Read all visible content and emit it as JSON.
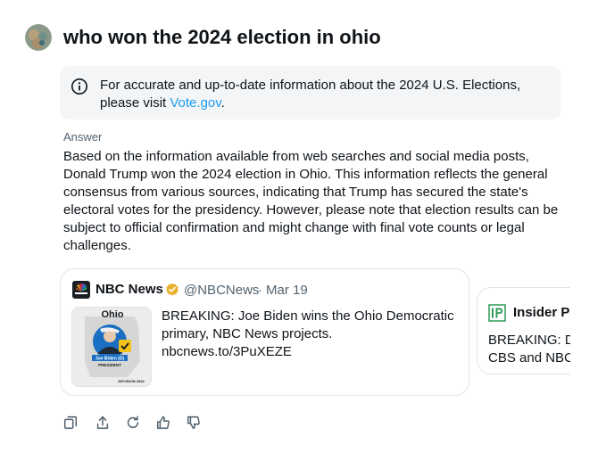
{
  "query": {
    "text": "who won the 2024 election in ohio"
  },
  "notice": {
    "text": "For accurate and up-to-date information about the 2024 U.S. Elections, please visit",
    "link_text": "Vote.gov",
    "suffix": ".",
    "icon": "info-icon"
  },
  "answer": {
    "label": "Answer",
    "text": "Based on the information available from web searches and social media posts, Donald Trump won the 2024 election in Ohio. This information reflects the general consensus from various sources, indicating that Trump has secured the state's electoral votes for the presidency. However, please note that election results can be subject to official confirmation and might change with final vote counts or legal challenges."
  },
  "sources": [
    {
      "name": "NBC News",
      "handle": "@NBCNews",
      "separator": "·",
      "date": "Mar 19",
      "verified": true,
      "text": "BREAKING: Joe Biden wins the Ohio Democratic primary, NBC News projects. nbcnews.to/3PuXEZE",
      "thumb": {
        "state_label": "Ohio",
        "candidate_label": "Joe Biden (D)",
        "office_label": "PRESIDENT",
        "footer_label": "DECISION 2024"
      }
    },
    {
      "name": "Insider Pa",
      "logo_text": "IP",
      "text_line1": "BREAKING: Dc",
      "text_line2": "CBS and NBC"
    }
  ],
  "actions": [
    "copy-icon",
    "share-icon",
    "regenerate-icon",
    "thumbs-up-icon",
    "thumbs-down-icon"
  ],
  "colors": {
    "link": "#1d9bf0",
    "muted": "#536471",
    "verified": "#e8b22d",
    "notice_bg": "#f3f5f6"
  }
}
